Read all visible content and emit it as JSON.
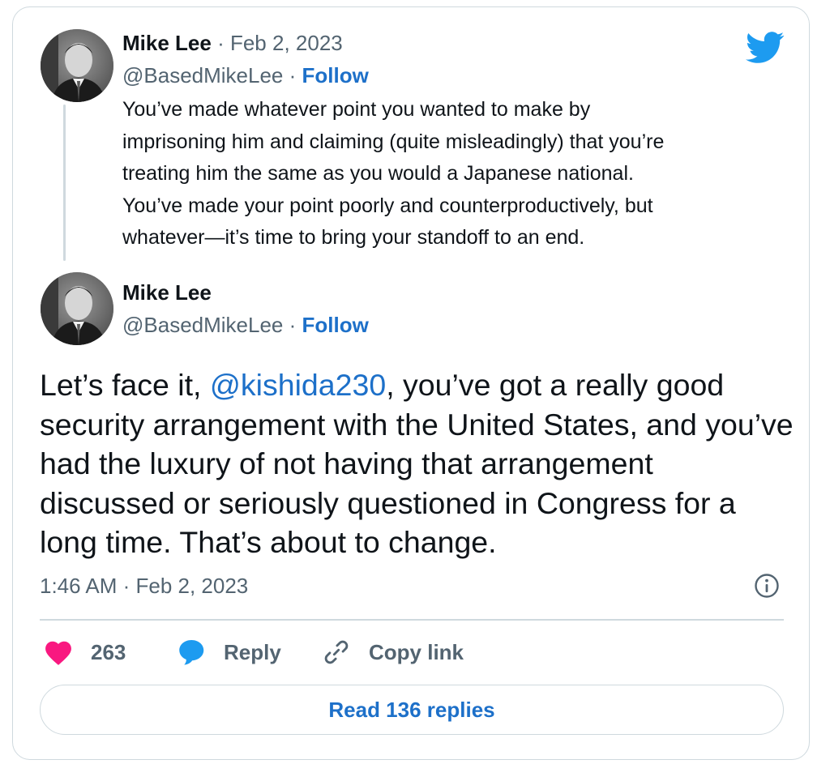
{
  "parent_tweet": {
    "author_name": "Mike Lee",
    "separator": "·",
    "date": "Feb 2, 2023",
    "handle": "@BasedMikeLee",
    "follow_label": "Follow",
    "text_lines": [
      "You’ve made whatever point you wanted to make by",
      "imprisoning him and claiming (quite misleadingly) that you’re",
      "treating him the same as you would a Japanese national.",
      "You’ve made your point poorly and counterproductively, but",
      "whatever—it’s time to bring your standoff to an end."
    ],
    "avatar_icon": "profile-photo"
  },
  "main_tweet": {
    "author_name": "Mike Lee",
    "handle": "@BasedMikeLee",
    "separator": "·",
    "follow_label": "Follow",
    "text_before_mention": "Let’s face it, ",
    "mention": "@kishida230",
    "text_after_mention": ", you’ve got a really good security arrangement with the United States, and you’ve had the luxury of not having that arrangement discussed or seriously questioned in Congress for a long time. That’s about to change.",
    "timestamp": "1:46 AM · Feb 2, 2023",
    "avatar_icon": "profile-photo"
  },
  "actions": {
    "like_count": "263",
    "like_icon": "heart-icon",
    "reply_label": "Reply",
    "reply_icon": "speech-bubble-icon",
    "copy_link_label": "Copy link",
    "copy_link_icon": "link-icon"
  },
  "read_replies_label": "Read 136 replies",
  "icons": {
    "brand": "twitter-bird-icon",
    "info": "info-icon"
  },
  "colors": {
    "brand_blue": "#1d9bf0",
    "link_blue": "#1d70c9",
    "like_pink": "#f91880",
    "muted_text": "#536471",
    "border": "#cfd9de"
  }
}
